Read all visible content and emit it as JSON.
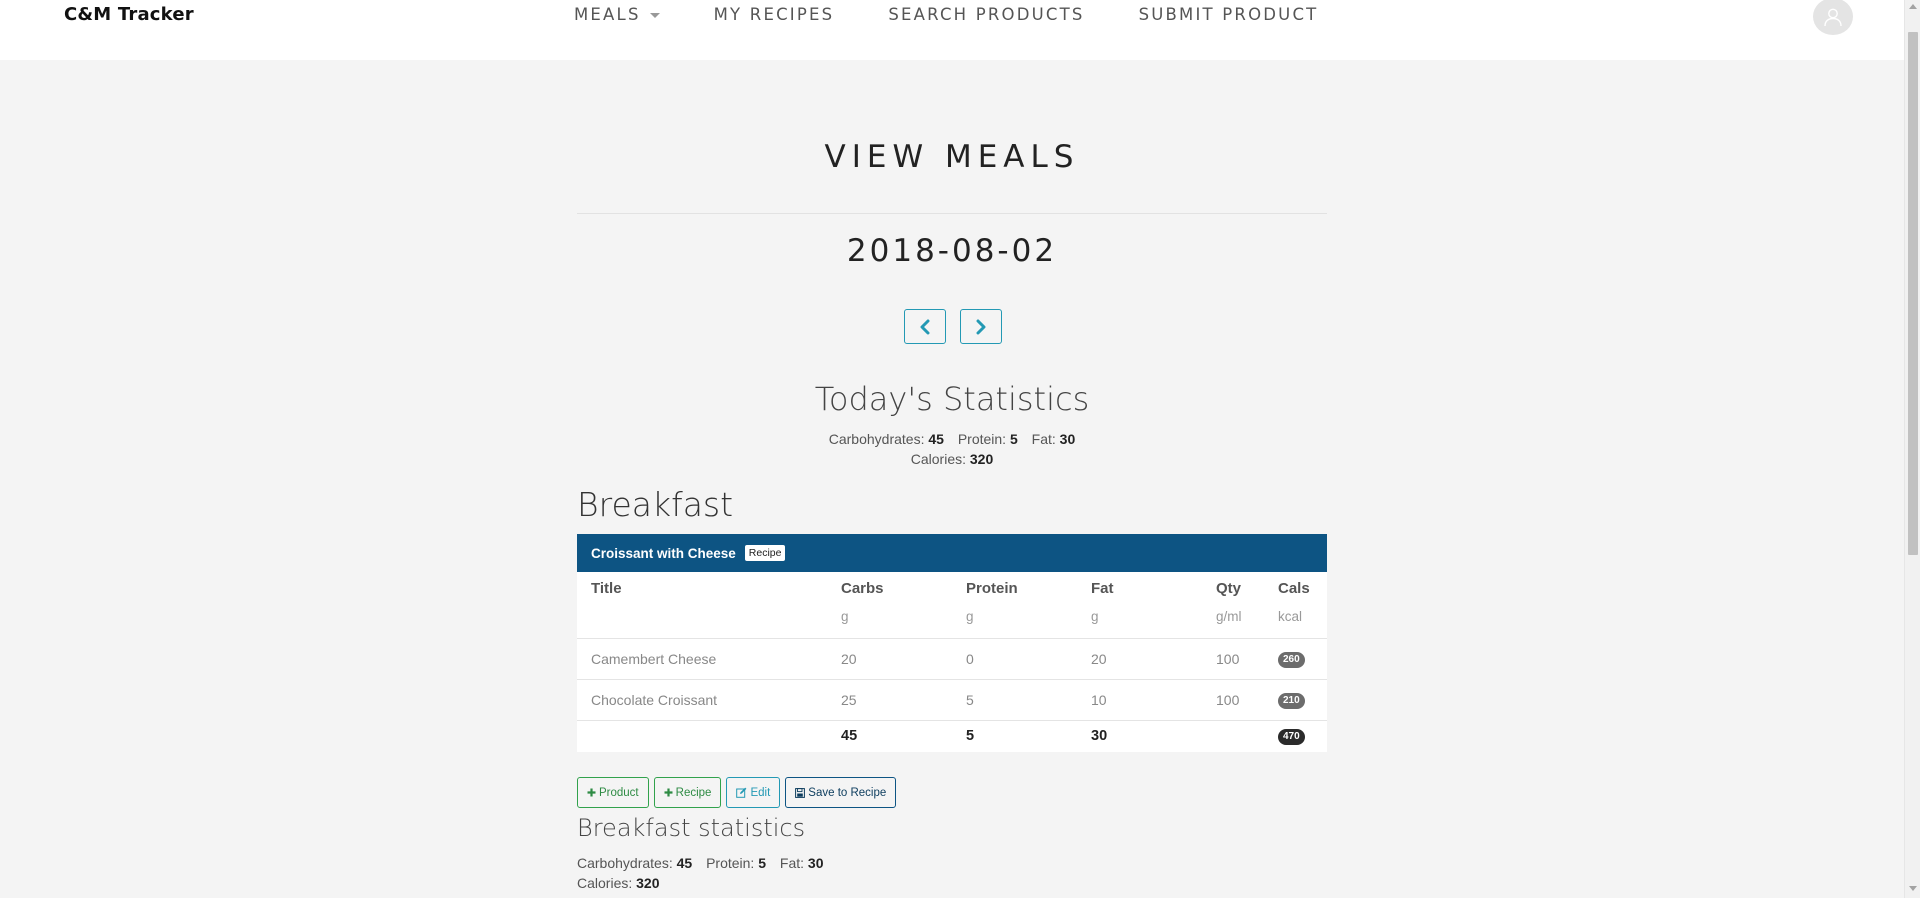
{
  "brand": "C&M Tracker",
  "nav": {
    "meals": "MEALS",
    "my_recipes": "MY RECIPES",
    "search_products": "SEARCH PRODUCTS",
    "submit_product": "SUBMIT PRODUCT"
  },
  "page": {
    "title": "VIEW MEALS",
    "date": "2018-08-02"
  },
  "today": {
    "title": "Today's Statistics",
    "carbs_label": "Carbohydrates:",
    "carbs": "45",
    "protein_label": "Protein:",
    "protein": "5",
    "fat_label": "Fat:",
    "fat": "30",
    "calories_label": "Calories:",
    "calories": "320"
  },
  "breakfast": {
    "title": "Breakfast",
    "recipe_name": "Croissant with Cheese",
    "recipe_badge": "Recipe",
    "columns": {
      "title": "Title",
      "carbs": "Carbs",
      "protein": "Protein",
      "fat": "Fat",
      "qty": "Qty",
      "cals": "Cals"
    },
    "units": {
      "carbs": "g",
      "protein": "g",
      "fat": "g",
      "qty": "g/ml",
      "cals": "kcal"
    },
    "rows": [
      {
        "title": "Camembert Cheese",
        "carbs": "20",
        "protein": "0",
        "fat": "20",
        "qty": "100",
        "cals": "260"
      },
      {
        "title": "Chocolate Croissant",
        "carbs": "25",
        "protein": "5",
        "fat": "10",
        "qty": "100",
        "cals": "210"
      }
    ],
    "totals": {
      "carbs": "45",
      "protein": "5",
      "fat": "30",
      "cals": "470"
    },
    "buttons": {
      "product": "Product",
      "recipe": "Recipe",
      "edit": "Edit",
      "save_to_recipe": "Save to Recipe"
    },
    "stats": {
      "title": "Breakfast statistics",
      "carbs_label": "Carbohydrates:",
      "carbs": "45",
      "protein_label": "Protein:",
      "protein": "5",
      "fat_label": "Fat:",
      "fat": "30",
      "calories_label": "Calories:",
      "calories": "320"
    }
  },
  "colors": {
    "accent_navy": "#0d5483",
    "accent_teal": "#2399b4",
    "success_green": "#31a24c",
    "page_background": "#f4f4f4"
  },
  "icons": {
    "meals_dropdown": "caret-down-icon",
    "account": "user-avatar-icon",
    "previous_day": "chevron-left-icon",
    "next_day": "chevron-right-icon",
    "add_product": "plus-icon",
    "add_recipe": "plus-icon",
    "edit": "pencil-square-icon",
    "save_to_recipe": "floppy-disk-icon"
  }
}
